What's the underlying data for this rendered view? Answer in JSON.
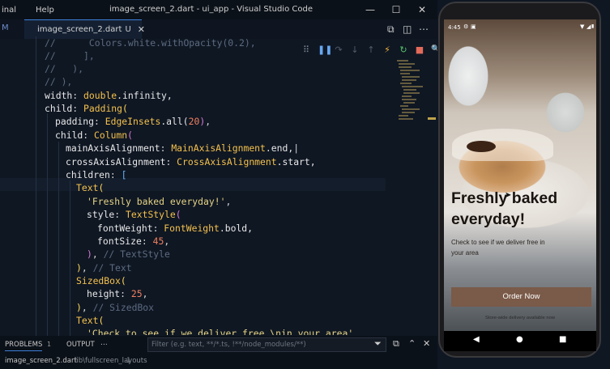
{
  "titlebar": {
    "menu": [
      "inal",
      "Help"
    ],
    "window_title": "image_screen_2.dart - ui_app - Visual Studio Code",
    "minimize": "—",
    "maximize": "☐",
    "close": "✕"
  },
  "tabbar": {
    "left_label": "M",
    "tab_name": "image_screen_2.dart",
    "tab_status": "U",
    "tab_close": "✕",
    "actions": [
      "⧉",
      "◫",
      "⋯"
    ]
  },
  "debug_toolbar": [
    "⠿",
    "❚❚",
    "↷",
    "↓",
    "↑",
    "⚡",
    "↻",
    "■",
    "🔍"
  ],
  "code": {
    "line1_comment": "//      Colors.white.withOpacity(0.2),",
    "line2_comment": "//     ],",
    "line3_comment": "//   ),",
    "line4_comment": "// ),",
    "width_prop": "width",
    "double_cls": "double",
    "infinity": ".infinity,",
    "child1_prop": "child",
    "padding_cls": "Padding",
    "padding_prop": "padding",
    "edgeinsets_cls": "EdgeInsets",
    "all_call": ".all(",
    "padding_value": "20",
    "child2_prop": "child",
    "column_cls": "Column",
    "mainaxis_prop": "mainAxisAlignment",
    "mainaxis_cls": "MainAxisAlignment",
    "mainaxis_val": ".end,",
    "crossaxis_prop": "crossAxisAlignment",
    "crossaxis_cls": "CrossAxisAlignment",
    "crossaxis_val": ".start,",
    "children_prop": "children",
    "children_open": "[",
    "text_cls": "Text",
    "headline_str": "'Freshly baked everyday!'",
    "style_prop": "style",
    "textstyle_cls": "TextStyle",
    "fontweight_prop": "fontWeight",
    "fontweight_cls": "FontWeight",
    "fontweight_val": ".bold,",
    "fontsize_prop": "fontSize",
    "fontsize_value": "45",
    "textstyle_comment": "// TextStyle",
    "text_comment": "// Text",
    "sizedbox_cls": "SizedBox",
    "height_prop": "height",
    "height_value": "25",
    "sizedbox_comment": "// SizedBox",
    "text2_cls": "Text",
    "sub_str": "'Check to see if we deliver free \\nin your area'"
  },
  "panel": {
    "problems": "PROBLEMS",
    "problems_count": "1",
    "output": "OUTPUT",
    "more": "⋯",
    "filter_placeholder": "Filter (e.g. text, **/*.ts, !**/node_modules/**)",
    "path_file": "image_screen_2.dart",
    "path_dir": "lib\\fullscreen_layouts",
    "path_count": "1"
  },
  "phone": {
    "time": "4:45",
    "headline": "Freshly baked everyday!",
    "subtext": "Check to see if we deliver free in your area",
    "order_button": "Order Now",
    "delivery_note": "Store-wide delivery available now",
    "nav_back": "◀",
    "nav_home": "●",
    "nav_recent": "■"
  },
  "colors": {
    "editor_bg": "#0f1723",
    "accent_blue": "#3d7fd9",
    "button_brown": "#7a5a48"
  }
}
